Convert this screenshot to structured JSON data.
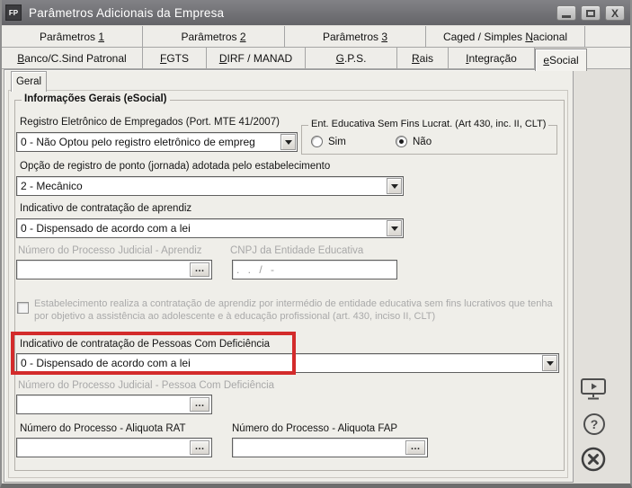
{
  "window": {
    "title": "Parâmetros Adicionais da Empresa",
    "icon_text": "FP"
  },
  "tabs_row1": [
    {
      "pre": "Parâmetros ",
      "accel": "1",
      "post": ""
    },
    {
      "pre": "Parâmetros ",
      "accel": "2",
      "post": ""
    },
    {
      "pre": "Parâmetros ",
      "accel": "3",
      "post": ""
    },
    {
      "pre": "Caged / Simples ",
      "accel": "N",
      "post": "acional"
    }
  ],
  "tabs_row2": [
    {
      "pre": "",
      "accel": "B",
      "post": "anco/C.Sind Patronal"
    },
    {
      "pre": "",
      "accel": "F",
      "post": "GTS"
    },
    {
      "pre": "",
      "accel": "D",
      "post": "IRF / MANAD"
    },
    {
      "pre": "",
      "accel": "G",
      "post": ".P.S."
    },
    {
      "pre": "",
      "accel": "R",
      "post": "ais"
    },
    {
      "pre": "",
      "accel": "I",
      "post": "ntegração"
    },
    {
      "pre": "",
      "accel": "e",
      "post": "Social",
      "selected": true
    }
  ],
  "subtab": "Geral",
  "groupbox_title": "Informações Gerais (eSocial)",
  "ui": {
    "ellipsis": "…"
  },
  "fields": {
    "registro_eletronico": {
      "label": "Registro Eletrônico de Empregados (Port. MTE 41/2007)",
      "value": "0 - Não Optou pelo registro eletrônico de empreg"
    },
    "ent_educativa": {
      "title": "Ent. Educativa Sem Fins Lucrat. (Art 430, inc. II, CLT)",
      "options": [
        {
          "label": "Sim",
          "selected": false
        },
        {
          "label": "Não",
          "selected": true
        }
      ]
    },
    "registro_ponto": {
      "label": "Opção de registro de ponto (jornada) adotada pelo estabelecimento",
      "value": "2 - Mecânico"
    },
    "aprendiz": {
      "label": "Indicativo de contratação de aprendiz",
      "value": "0 - Dispensado de acordo com a lei"
    },
    "processo_aprendiz": {
      "label": "Número do Processo Judicial - Aprendiz",
      "value": ""
    },
    "cnpj_entidade": {
      "label": "CNPJ da Entidade Educativa",
      "mask": ".  .  /  -"
    },
    "checkbox_estabelecimento": {
      "checked": false,
      "label_line1": "Estabelecimento realiza a contratação de aprendiz por intermédio de entidade educativa sem fins lucrativos que tenha",
      "label_line2": "por objetivo a assistência ao adolescente e à educação profissional (art. 430, inciso II, CLT)"
    },
    "pcd": {
      "label": "Indicativo de contratação de Pessoas Com Deficiência",
      "value": "0 - Dispensado de acordo com a lei"
    },
    "processo_pcd": {
      "label": "Número do Processo Judicial - Pessoa Com Deficiência",
      "value": ""
    },
    "processo_rat": {
      "label": "Número do Processo - Aliquota RAT",
      "value": ""
    },
    "processo_fap": {
      "label": "Número do Processo - Aliquota FAP",
      "value": ""
    }
  },
  "colors": {
    "highlight": "#d32b2b",
    "titlebar": "#737377"
  }
}
